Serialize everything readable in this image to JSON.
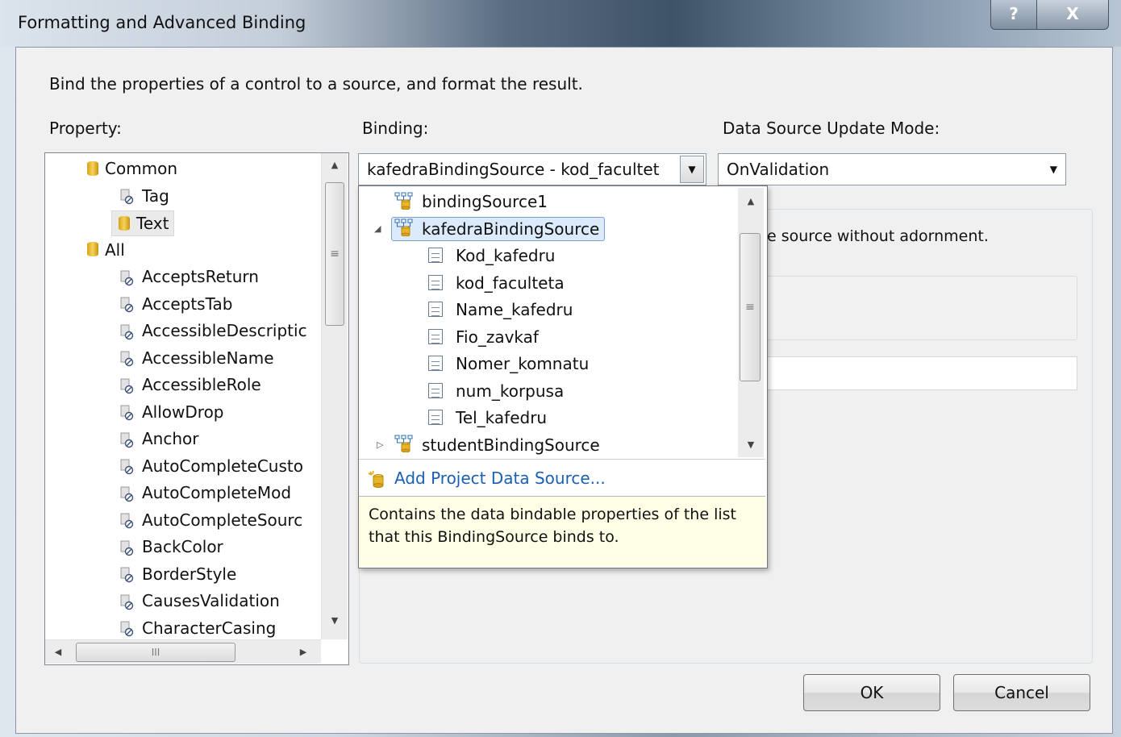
{
  "window": {
    "title": "Formatting and Advanced Binding",
    "help_label": "?",
    "close_label": "X"
  },
  "description": "Bind the properties of a control to a source, and format the result.",
  "property": {
    "label": "Property:",
    "tree": [
      {
        "label": "Common",
        "icon": "database-icon",
        "level": 0
      },
      {
        "label": "Tag",
        "icon": "property-icon",
        "level": 1
      },
      {
        "label": "Text",
        "icon": "database-icon",
        "level": 1,
        "selected": true
      },
      {
        "label": "All",
        "icon": "database-icon",
        "level": 0
      },
      {
        "label": "AcceptsReturn",
        "icon": "property-icon",
        "level": 1
      },
      {
        "label": "AcceptsTab",
        "icon": "property-icon",
        "level": 1
      },
      {
        "label": "AccessibleDescriptic",
        "icon": "property-icon",
        "level": 1
      },
      {
        "label": "AccessibleName",
        "icon": "property-icon",
        "level": 1
      },
      {
        "label": "AccessibleRole",
        "icon": "property-icon",
        "level": 1
      },
      {
        "label": "AllowDrop",
        "icon": "property-icon",
        "level": 1
      },
      {
        "label": "Anchor",
        "icon": "property-icon",
        "level": 1
      },
      {
        "label": "AutoCompleteCusto",
        "icon": "property-icon",
        "level": 1
      },
      {
        "label": "AutoCompleteMod",
        "icon": "property-icon",
        "level": 1
      },
      {
        "label": "AutoCompleteSourc",
        "icon": "property-icon",
        "level": 1
      },
      {
        "label": "BackColor",
        "icon": "property-icon",
        "level": 1
      },
      {
        "label": "BorderStyle",
        "icon": "property-icon",
        "level": 1
      },
      {
        "label": "CausesValidation",
        "icon": "property-icon",
        "level": 1
      },
      {
        "label": "CharacterCasing",
        "icon": "property-icon",
        "level": 1
      }
    ]
  },
  "binding": {
    "label": "Binding:",
    "value": "kafedraBindingSource - kod_facultet",
    "dropdown": {
      "items": [
        {
          "label": "bindingSource1",
          "icon": "binding-source-icon",
          "level": 0,
          "expander": ""
        },
        {
          "label": "kafedraBindingSource",
          "icon": "binding-source-icon",
          "level": 0,
          "expander": "◢",
          "selected": true
        },
        {
          "label": "Kod_kafedru",
          "icon": "field-icon",
          "level": 1
        },
        {
          "label": "kod_faculteta",
          "icon": "field-icon",
          "level": 1
        },
        {
          "label": "Name_kafedru",
          "icon": "field-icon",
          "level": 1
        },
        {
          "label": "Fio_zavkaf",
          "icon": "field-icon",
          "level": 1
        },
        {
          "label": "Nomer_komnatu",
          "icon": "field-icon",
          "level": 1
        },
        {
          "label": "num_korpusa",
          "icon": "field-icon",
          "level": 1
        },
        {
          "label": "Tel_kafedru",
          "icon": "field-icon",
          "level": 1
        },
        {
          "label": "studentBindingSource",
          "icon": "binding-source-icon",
          "level": 0,
          "expander": "▷"
        }
      ],
      "add_source_label": "Add Project Data Source...",
      "description": "Contains the data bindable properties of the list that this BindingSource binds to."
    }
  },
  "update_mode": {
    "label": "Data Source Update Mode:",
    "value": "OnValidation"
  },
  "format": {
    "partial_text": "e source without adornment."
  },
  "buttons": {
    "ok": "OK",
    "cancel": "Cancel"
  },
  "colors": {
    "link": "#1a5fb4",
    "selection_border": "#7da2ce",
    "selection_fill": "#dcebfc",
    "description_bg": "#ffffe6"
  }
}
